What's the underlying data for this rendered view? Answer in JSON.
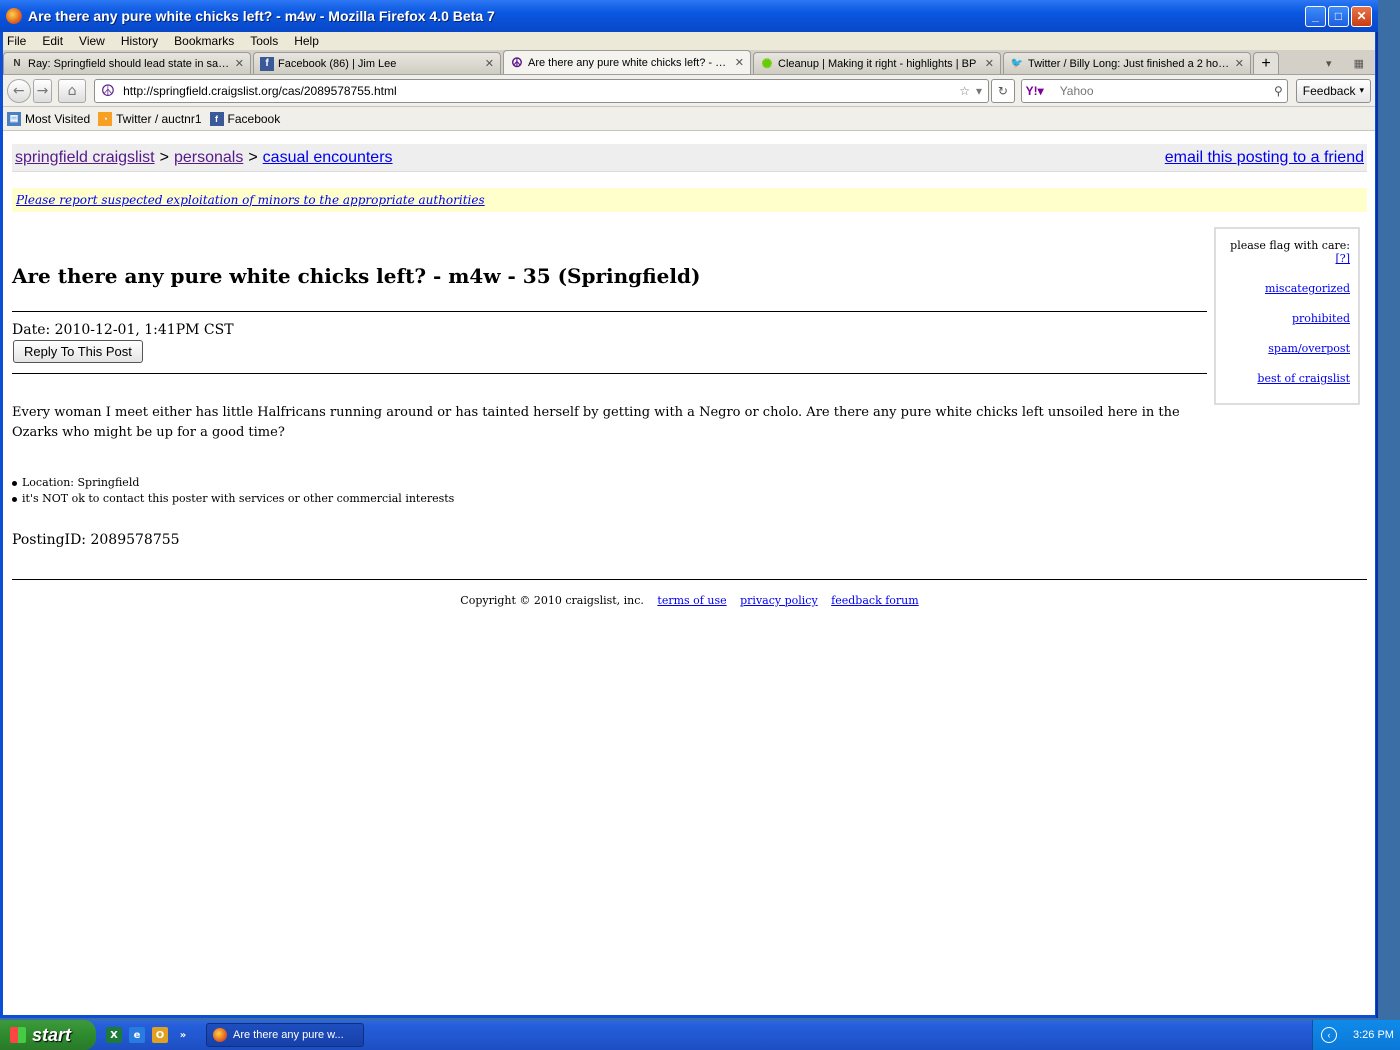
{
  "window": {
    "title": "Are there any pure white chicks left? - m4w - Mozilla Firefox 4.0 Beta 7"
  },
  "menu": [
    "File",
    "Edit",
    "View",
    "History",
    "Bookmarks",
    "Tools",
    "Help"
  ],
  "tabs": [
    {
      "label": "Ray: Springfield should lead state in sayi...",
      "icon": "news-leader-icon"
    },
    {
      "label": "Facebook (86) | Jim Lee",
      "icon": "facebook-icon"
    },
    {
      "label": "Are there any pure white chicks left? - m...",
      "icon": "peace-icon",
      "active": true
    },
    {
      "label": "Cleanup | Making it right - highlights | BP",
      "icon": "bp-icon"
    },
    {
      "label": "Twitter / Billy Long: Just finished a 2 hou...",
      "icon": "twitter-icon"
    }
  ],
  "nav": {
    "url": "http://springfield.craigslist.org/cas/2089578755.html",
    "search_placeholder": "Yahoo",
    "feedback_label": "Feedback"
  },
  "bookmarks": [
    {
      "label": "Most Visited",
      "icon": "most-visited-icon"
    },
    {
      "label": "Twitter / auctnr1",
      "icon": "rss-icon"
    },
    {
      "label": "Facebook",
      "icon": "facebook-icon"
    }
  ],
  "page": {
    "breadcrumb": {
      "site": "springfield craigslist",
      "section": "personals",
      "category": "casual encounters",
      "sep": ">"
    },
    "email_link": "email this posting to a friend",
    "warning": "Please report suspected exploitation of minors to the appropriate authorities",
    "flag": {
      "heading": "please flag with care:",
      "help": "[?]",
      "options": [
        "miscategorized",
        "prohibited",
        "spam/overpost",
        "best of craigslist"
      ]
    },
    "title": "Are there any pure white chicks left? - m4w - 35 (Springfield)",
    "date": "Date: 2010-12-01,  1:41PM CST",
    "reply_label": "Reply To This Post",
    "body": "Every woman I meet either has little Halfricans running around or has tainted herself by getting with a Negro or cholo. Are there any pure white chicks left unsoiled here in the Ozarks who might be up for a good time?",
    "bullets": [
      "Location: Springfield",
      "it's NOT ok to contact this poster with services or other commercial interests"
    ],
    "posting_id": "PostingID: 2089578755",
    "footer": {
      "copyright": "Copyright © 2010 craigslist, inc.",
      "links": [
        "terms of use",
        "privacy policy",
        "feedback forum"
      ]
    }
  },
  "taskbar": {
    "start_label": "start",
    "task_label": "Are there any pure w...",
    "clock": "3:26 PM"
  }
}
